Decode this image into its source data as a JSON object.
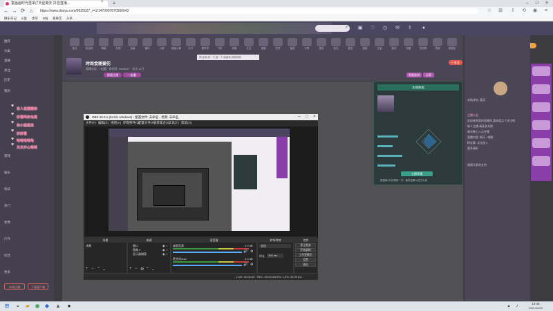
{
  "browser": {
    "tab_title": "童画画时光里来(7天星期天 抖音直播…",
    "tab_close": "×",
    "new_tab": "+",
    "url": "https://www.douyu.com/9625027_r=1/1470007870560043",
    "bookmarks": [
      "微乐日记",
      "斗鱼",
      "虎牙",
      "B站",
      "爱奇艺",
      "头条"
    ]
  },
  "site": {
    "search_icon": "search-icon",
    "notice_text": "好!点亮,来一个,放一个,给我来,你你你你",
    "streamer_name": "时尚金丽姜佗",
    "room_info": "直播分区: 一起看 · 房间号: 9625027 · 关注 12万",
    "tag1": "颜值主播",
    "tag2": "一起看",
    "follow_label": "+ 关注",
    "report_label": "举报房间",
    "share_label": "分享",
    "pc_badge": "PC客户端",
    "gift_labels": [
      "鱼丸",
      "粉丝牌",
      "弹幕",
      "礼物",
      "贡献",
      "福利",
      "火箭",
      "超级火箭",
      "办卡",
      "嘉年华",
      "飞机",
      "游艇",
      "红包",
      "宝箱",
      "任务",
      "抽奖",
      "分享",
      "更多",
      "钻石",
      "星空",
      "超跑",
      "王者",
      "魔法",
      "流星",
      "荧光棒",
      "贵族",
      "超值包"
    ],
    "sidebar_items": [
      "推荐",
      "分类",
      "直播",
      "关注",
      "历史",
      "我的",
      "游戏",
      "娱乐",
      "科技",
      "热门",
      "星秀",
      "户外",
      "综合",
      "更多"
    ],
    "sidebar_btn1": "申请主播",
    "sidebar_btn2": "下载客户端",
    "chat_overlay": [
      "有人说我跟你",
      "好看吗你也是",
      "你小姐姐真",
      "好好看",
      "哈哈哈哈哈",
      "天天开心呀呀"
    ],
    "rp_lines": [
      "本场排名: 暂无",
      "主播公告",
      "欢迎来到我的直播间,喜欢就点个关注吧",
      "新人主播,请多多关照",
      "每天晚上八点开播",
      "直播内容: 聊天 / 唱歌",
      "粉丝群: 点击加入",
      "更多精彩",
      "谢谢大家的支持"
    ]
  },
  "card": {
    "title": "主播数据",
    "button": "立即开通",
    "footer": "数据每5分钟更新一次 · 最终结果以官方为准"
  },
  "obs": {
    "title": "OBS 26.0.1 (64 bit, windows) - 配置文件: 未命名 - 场景: 未命名",
    "menu": [
      "文件(F)",
      "编辑(E)",
      "视图(V)",
      "停靠部件(D)",
      "配置文件(P)",
      "场景集合(S)",
      "工具(T)",
      "帮助(H)"
    ],
    "docks": {
      "scenes": "场景",
      "sources": "来源",
      "mixer": "混音器",
      "transitions": "转场特效",
      "controls": "控件"
    },
    "scene_item": "场景",
    "sources_list": [
      "窗口",
      "图像 2",
      "显示器捕获"
    ],
    "mixer_tracks": [
      {
        "name": "桌面音频",
        "db": "0.0 dB"
      },
      {
        "name": "麦克风/Aux",
        "db": "0.0 dB"
      }
    ],
    "transition_type": "淡出",
    "duration_label": "时长",
    "duration_value": "300 ms",
    "controls": [
      "停止推流",
      "开始录制",
      "工作室模式",
      "设置",
      "退出"
    ],
    "status": {
      "live": "LIVE: 00:00:00",
      "rec": "REC: 00:00:00",
      "cpu": "CPU: 1.3%, 30.00 fps"
    }
  },
  "taskbar": {
    "time": "19:46",
    "date": "2021/12/10"
  },
  "colors": {
    "site_bg": "#4a4656",
    "obs_bg": "#2e2e2e",
    "accent_purple": "#8a3fa8",
    "accent_teal": "#3aa08a",
    "chat_pink": "#ff6a9a"
  }
}
